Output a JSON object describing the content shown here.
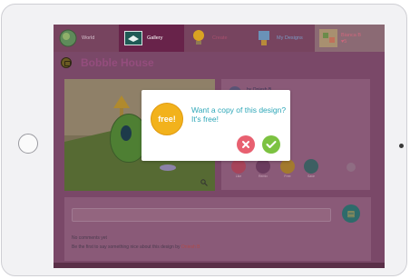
{
  "tabs": {
    "world": "World",
    "gallery": "Gallery",
    "create": "Create",
    "my_designs": "My Designs",
    "profile_name": "Bianca B",
    "profile_hearts": "♥5"
  },
  "page": {
    "title": "Bobble House"
  },
  "info": {
    "author": "by Oniesh B"
  },
  "badges": [
    "Like",
    "Remix",
    "Free",
    "Save"
  ],
  "comments": {
    "empty_text": "No comments yet",
    "prompt_prefix": "Be the first to say something nice about this design by ",
    "prompt_user": "Oniesh B"
  },
  "dialog": {
    "badge_text": "free!",
    "message": "Want a copy of this design? It's free!"
  },
  "colors": {
    "accent_teal": "#2ea7b8",
    "yes_green": "#7cc241",
    "no_red": "#e86070",
    "free_yellow": "#f2b21c"
  }
}
